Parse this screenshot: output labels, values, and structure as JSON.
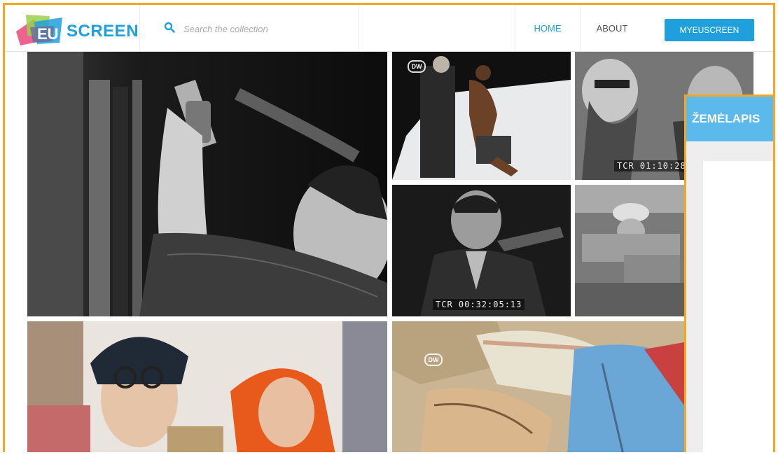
{
  "header": {
    "logo_text": "SCREEN",
    "logo_badge": "EU",
    "search": {
      "placeholder": "Search the collection",
      "value": ""
    },
    "nav": {
      "home": "HOME",
      "about": "ABOUT",
      "my": "MYEUSCREEN"
    }
  },
  "tiles": {
    "t2": {
      "badge": "DW"
    },
    "t3": {
      "timecode": "TCR 01:10:28"
    },
    "t4": {
      "timecode": "TCR 00:32:05:13"
    },
    "t7": {
      "badge": "DW"
    }
  },
  "side_panel": {
    "tab_label": "ŽEMĖLAPIS"
  },
  "colors": {
    "accent": "#1fa0dc",
    "frame": "#f5a623",
    "panel_tab": "#5cb9ec"
  }
}
